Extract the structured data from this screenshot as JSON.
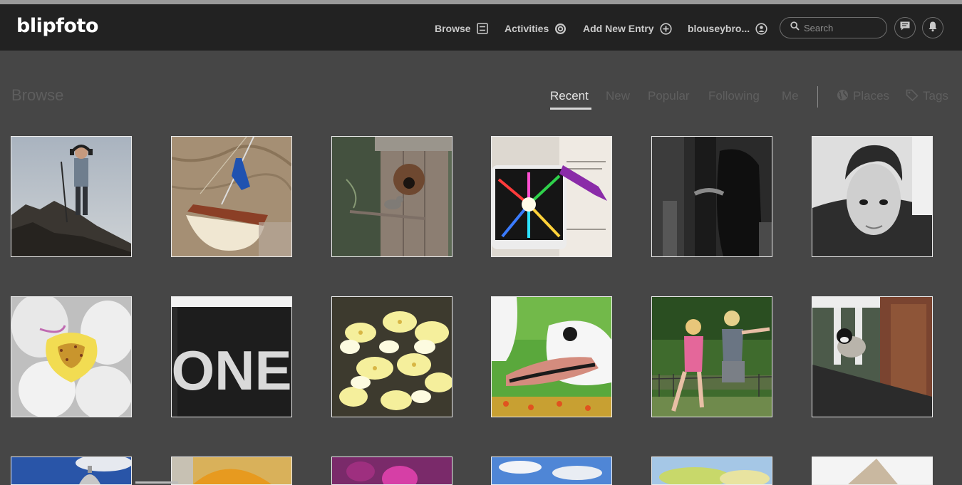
{
  "app": {
    "logo": "blipfoto"
  },
  "header": {
    "nav": [
      {
        "label": "Browse",
        "icon": "browse-grid-icon"
      },
      {
        "label": "Activities",
        "icon": "activities-icon"
      },
      {
        "label": "Add New Entry",
        "icon": "plus-circle-icon"
      },
      {
        "label": "blouseybro...",
        "icon": "user-icon"
      }
    ],
    "search_placeholder": "Search",
    "icons": [
      "search-icon",
      "messages-icon",
      "notifications-bell-icon"
    ]
  },
  "page": {
    "title": "Browse",
    "tabs": [
      {
        "label": "Recent",
        "active": true
      },
      {
        "label": "New",
        "active": false
      },
      {
        "label": "Popular",
        "active": false
      },
      {
        "label": "Following",
        "active": false
      },
      {
        "label": "Me",
        "active": false
      }
    ],
    "extra_tabs": [
      {
        "label": "Places",
        "icon": "globe-icon"
      },
      {
        "label": "Tags",
        "icon": "tag-icon"
      }
    ]
  },
  "thumbnails": [
    {
      "id": "boy-on-rock"
    },
    {
      "id": "boat-on-sand"
    },
    {
      "id": "bird-at-birdhouse"
    },
    {
      "id": "prism-phone"
    },
    {
      "id": "dark-figure"
    },
    {
      "id": "boy-portrait"
    },
    {
      "id": "white-orchid"
    },
    {
      "id": "one-sign",
      "text": "ONE"
    },
    {
      "id": "yellow-flowers"
    },
    {
      "id": "swan-head"
    },
    {
      "id": "kids-playing"
    },
    {
      "id": "chickadee-on-post"
    },
    {
      "id": "dome-sky"
    },
    {
      "id": "orange-canopy"
    },
    {
      "id": "pink-flower"
    },
    {
      "id": "blue-sky-clouds"
    },
    {
      "id": "spring-blossoms"
    },
    {
      "id": "white-object"
    }
  ],
  "colors": {
    "header_bg": "#222222",
    "page_bg": "#464646",
    "active_tab": "#e4e4e4",
    "inactive_tab": "#5f5f5f"
  }
}
